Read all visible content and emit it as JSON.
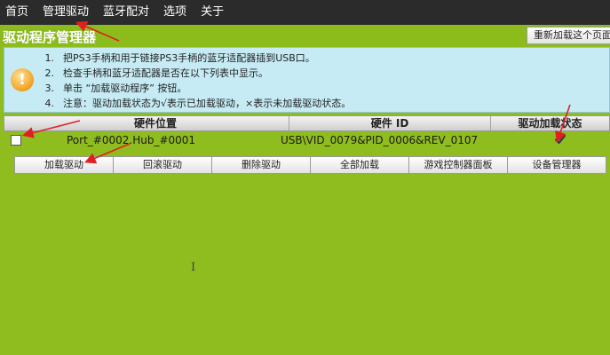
{
  "menubar": {
    "items": [
      "首页",
      "管理驱动",
      "蓝牙配对",
      "选项",
      "关于"
    ]
  },
  "app": {
    "title": "驱动程序管理器",
    "reload_button": "重新加载这个页面"
  },
  "info": {
    "icon": "warning-icon",
    "lines": [
      {
        "num": "1.",
        "text": "把PS3手柄和用于链接PS3手柄的蓝牙适配器插到USB口。"
      },
      {
        "num": "2.",
        "text": "检查手柄和蓝牙适配器是否在以下列表中显示。"
      },
      {
        "num": "3.",
        "text": "单击 “加载驱动程序” 按钮。"
      },
      {
        "num": "4.",
        "text": "注意：驱动加载状态为√表示已加载驱动，×表示未加载驱动状态。"
      }
    ]
  },
  "table": {
    "columns": [
      "硬件位置",
      "硬件 ID",
      "驱动加载状态"
    ],
    "rows": [
      {
        "checked": false,
        "location": "Port_#0002.Hub_#0001",
        "hardware_id": "USB\\VID_0079&PID_0006&REV_0107",
        "status": "loaded"
      }
    ]
  },
  "buttons": [
    "加载驱动",
    "回滚驱动",
    "删除驱动",
    "全部加载",
    "游戏控制器面板",
    "设备管理器"
  ],
  "colors": {
    "background": "#8fbd1f",
    "menubar": "#2b2b2b",
    "info_panel": "#c6ebf4",
    "annotation_arrow": "#e02020"
  }
}
